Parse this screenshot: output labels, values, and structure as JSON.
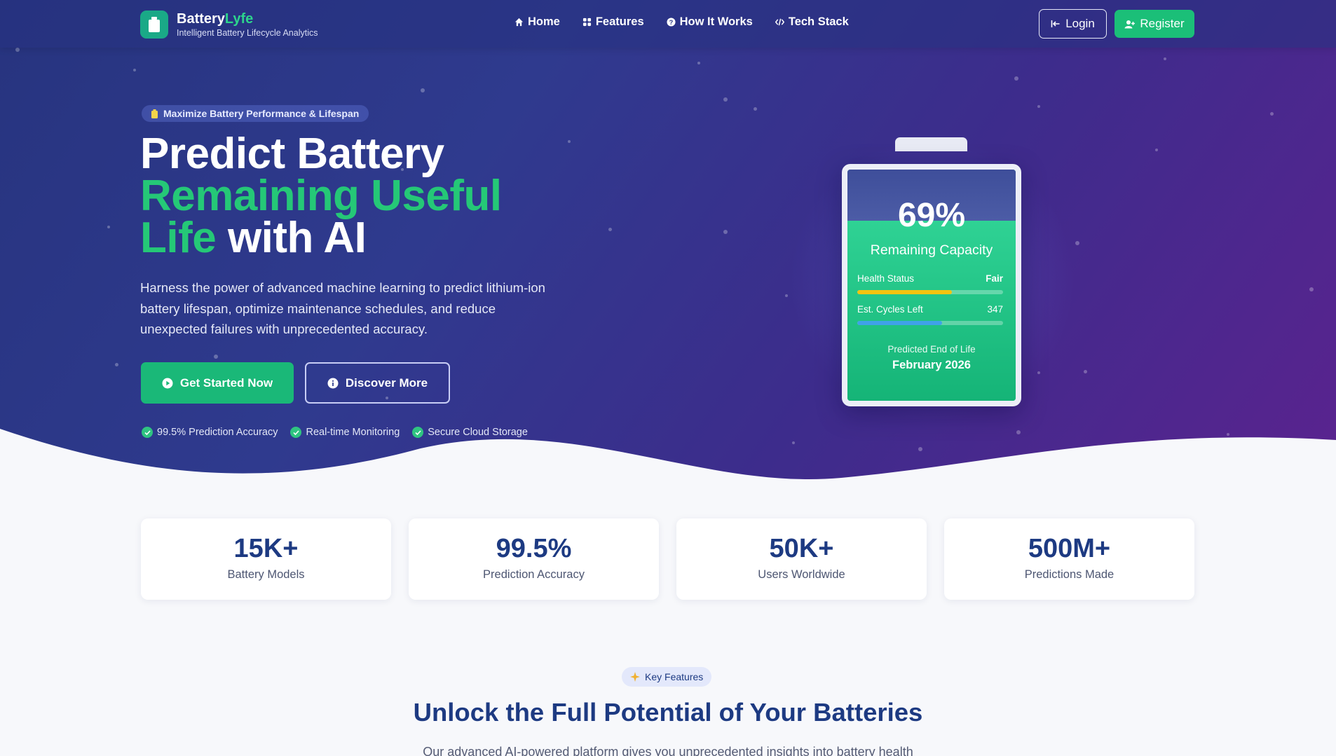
{
  "brand": {
    "name_main": "Battery",
    "name_accent": "Lyfe",
    "tagline": "Intelligent Battery Lifecycle Analytics",
    "icon": "battery-icon"
  },
  "nav": {
    "links": [
      {
        "label": "Home",
        "icon": "home-icon"
      },
      {
        "label": "Features",
        "icon": "grid-icon"
      },
      {
        "label": "How It Works",
        "icon": "question-icon"
      },
      {
        "label": "Tech Stack",
        "icon": "code-icon"
      }
    ],
    "login_label": "Login",
    "register_label": "Register"
  },
  "hero": {
    "pill": "Maximize Battery Performance & Lifespan",
    "headline_line1": "Predict Battery",
    "headline_line2": "Remaining Useful",
    "headline_line3_green": "Life",
    "headline_line3_rest": " with AI",
    "lead": "Harness the power of advanced machine learning to predict lithium-ion battery lifespan, optimize maintenance schedules, and reduce unexpected failures with unprecedented accuracy.",
    "cta_primary": "Get Started Now",
    "cta_secondary": "Discover More",
    "checks": [
      "99.5% Prediction Accuracy",
      "Real-time Monitoring",
      "Secure Cloud Storage"
    ]
  },
  "battery": {
    "percent": "69%",
    "percent_value": 69,
    "label": "Remaining Capacity",
    "health_label": "Health Status",
    "health_value": "Fair",
    "health_fill": 0.65,
    "cycles_label": "Est. Cycles Left",
    "cycles_value": "347",
    "cycles_fill": 0.58,
    "eol_label": "Predicted End of Life",
    "eol_value": "February 2026"
  },
  "stats": [
    {
      "value": "15K+",
      "label": "Battery Models"
    },
    {
      "value": "99.5%",
      "label": "Prediction Accuracy"
    },
    {
      "value": "50K+",
      "label": "Users Worldwide"
    },
    {
      "value": "500M+",
      "label": "Predictions Made"
    }
  ],
  "features": {
    "pill": "Key Features",
    "title": "Unlock the Full Potential of Your Batteries",
    "subtitle": "Our advanced AI-powered platform gives you unprecedented insights into battery health"
  },
  "colors": {
    "accent_green": "#1bbf78",
    "navy": "#1d3a82",
    "hero_start": "#27347f",
    "hero_end": "#5a238f"
  }
}
